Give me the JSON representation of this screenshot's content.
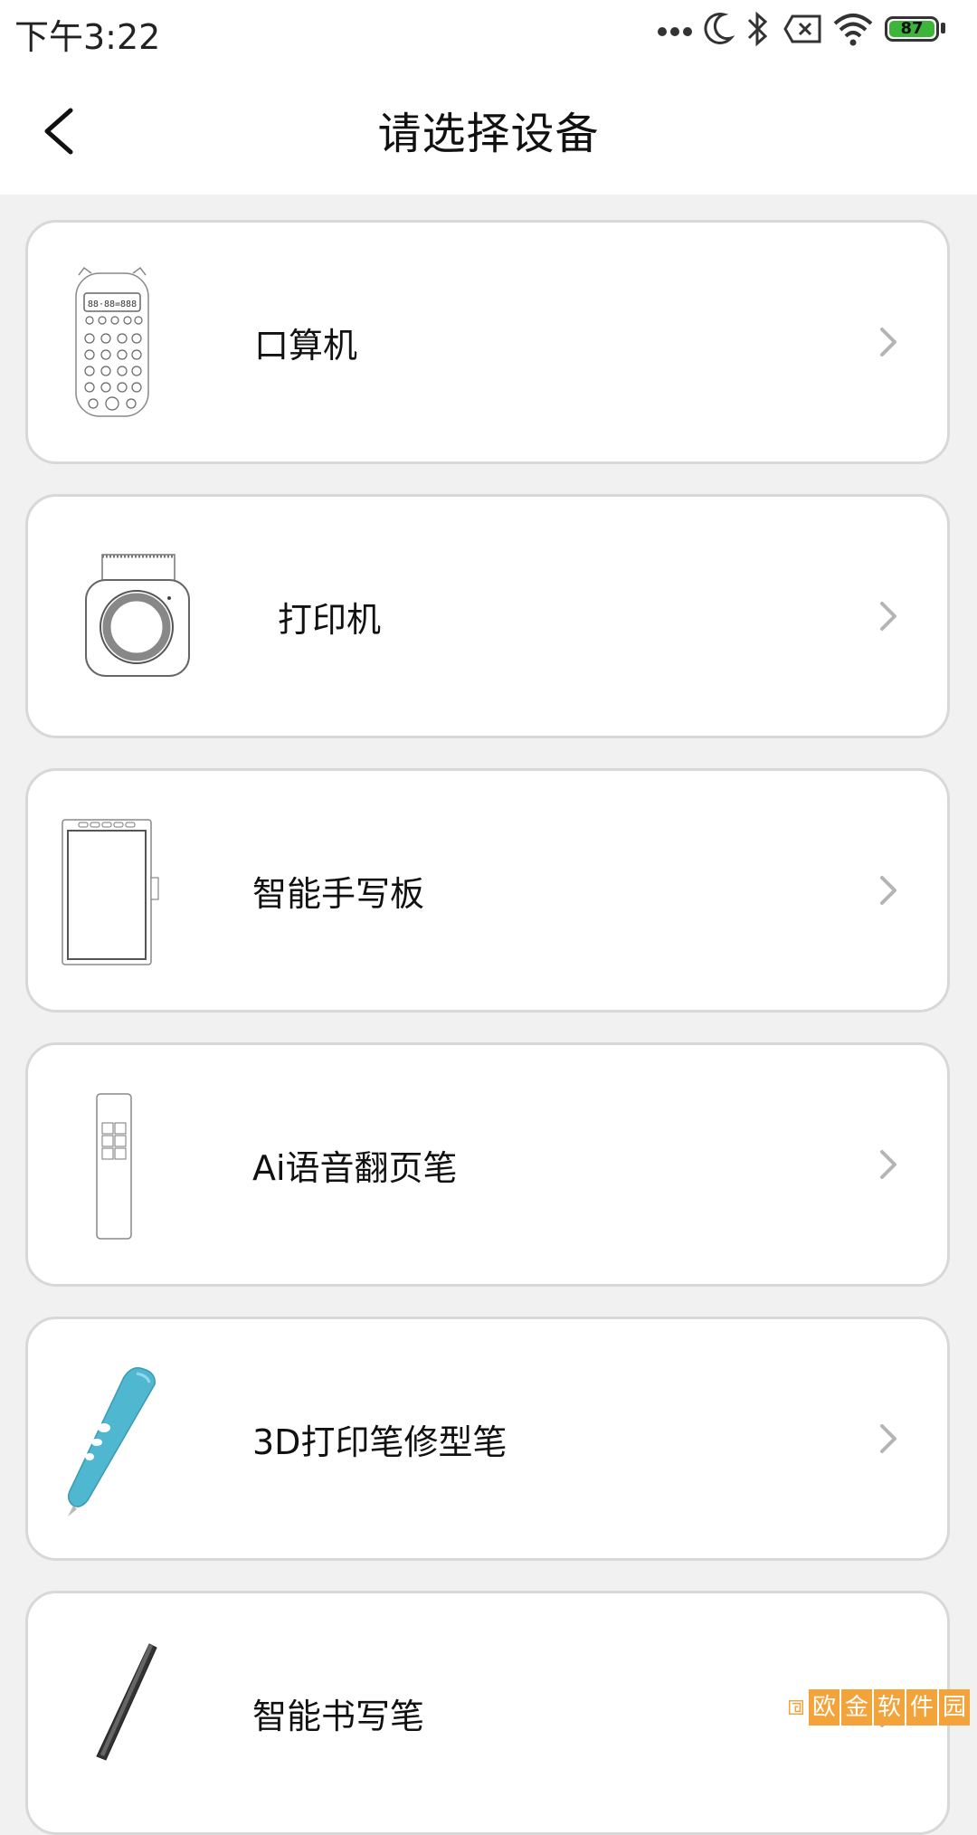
{
  "status_bar": {
    "time": "下午3:22",
    "battery": "87",
    "icons": [
      "more-dots-icon",
      "moon-icon",
      "bluetooth-icon",
      "sim-x-icon",
      "wifi-icon",
      "battery-icon"
    ]
  },
  "header": {
    "title": "请选择设备",
    "back_icon": "chevron-left-icon"
  },
  "devices": [
    {
      "label": "口算机",
      "image": "calculator-device"
    },
    {
      "label": "打印机",
      "image": "printer-device"
    },
    {
      "label": "智能手写板",
      "image": "writing-tablet-device"
    },
    {
      "label": "Ai语音翻页笔",
      "image": "presenter-pen-device"
    },
    {
      "label": "3D打印笔修型笔",
      "image": "3d-pen-device"
    },
    {
      "label": "智能书写笔",
      "image": "smart-pen-device"
    }
  ],
  "watermark": {
    "text": "欧金软件园"
  },
  "colors": {
    "accent_pen": "#4fb8d0",
    "card_border": "#d8d8d8",
    "battery": "#3cb53a"
  }
}
